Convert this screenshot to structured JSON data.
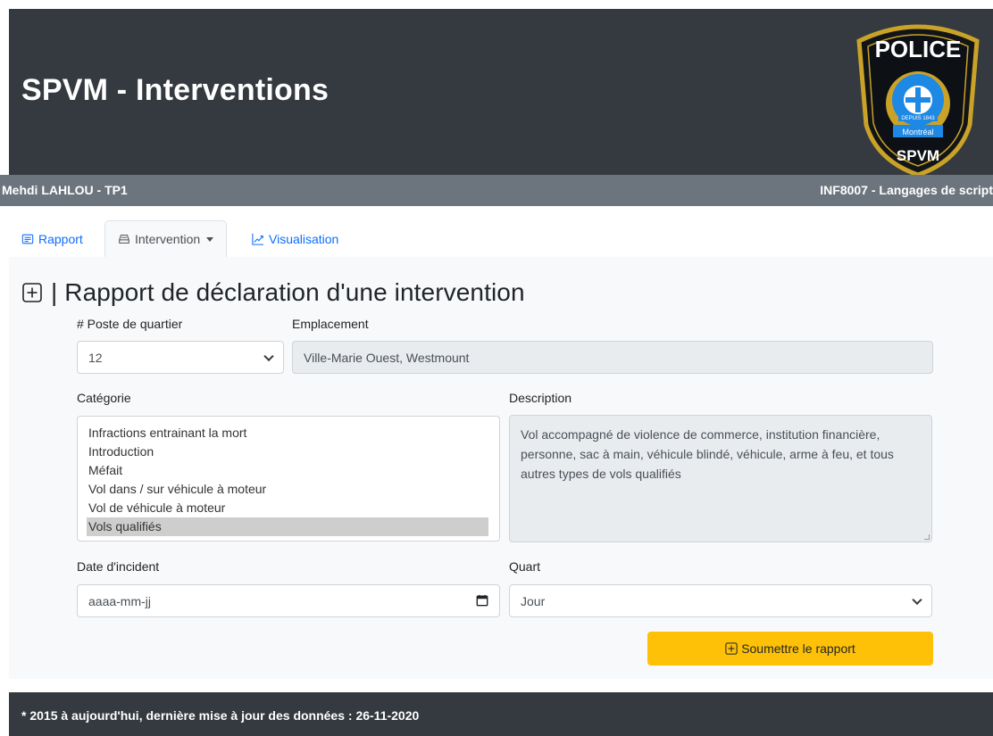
{
  "header": {
    "title": "SPVM - Interventions",
    "logo": {
      "top_text": "POLICE",
      "since": "DEPUIS 1843",
      "city": "Montréal",
      "bottom_text": "SPVM"
    }
  },
  "subbar": {
    "left": "Mehdi LAHLOU - TP1",
    "right": "INF8007 - Langages de script"
  },
  "tabs": [
    {
      "label": "Rapport",
      "icon": "report-icon"
    },
    {
      "label": "Intervention",
      "icon": "tray-icon",
      "active": true,
      "dropdown": true
    },
    {
      "label": "Visualisation",
      "icon": "graph-up-icon"
    }
  ],
  "form": {
    "title": "Rapport de déclaration d'une intervention",
    "poste": {
      "label": "# Poste de quartier",
      "value": "12"
    },
    "emplacement": {
      "label": "Emplacement",
      "value": "Ville-Marie Ouest, Westmount"
    },
    "categorie": {
      "label": "Catégorie",
      "options": [
        "Infractions entrainant la mort",
        "Introduction",
        "Méfait",
        "Vol dans / sur véhicule à moteur",
        "Vol de véhicule à moteur",
        "Vols qualifiés"
      ],
      "selected": "Vols qualifiés"
    },
    "description": {
      "label": "Description",
      "value": "Vol accompagné de violence de commerce, institution financière, personne, sac à main, véhicule blindé, véhicule, arme à feu, et tous autres types de vols qualifiés"
    },
    "date": {
      "label": "Date d'incident",
      "placeholder": "aaaa-mm-jj"
    },
    "quart": {
      "label": "Quart",
      "value": "Jour"
    },
    "submit_label": "Soumettre le rapport"
  },
  "footer": {
    "text": "* 2015 à aujourd'hui, dernière mise à jour des données : 26-11-2020"
  },
  "colors": {
    "header_bg": "#343a40",
    "subbar_bg": "#6c757d",
    "link": "#0d6efd",
    "submit_bg": "#ffc107",
    "badge_blue": "#1e88e5",
    "badge_gold": "#c9a227"
  }
}
